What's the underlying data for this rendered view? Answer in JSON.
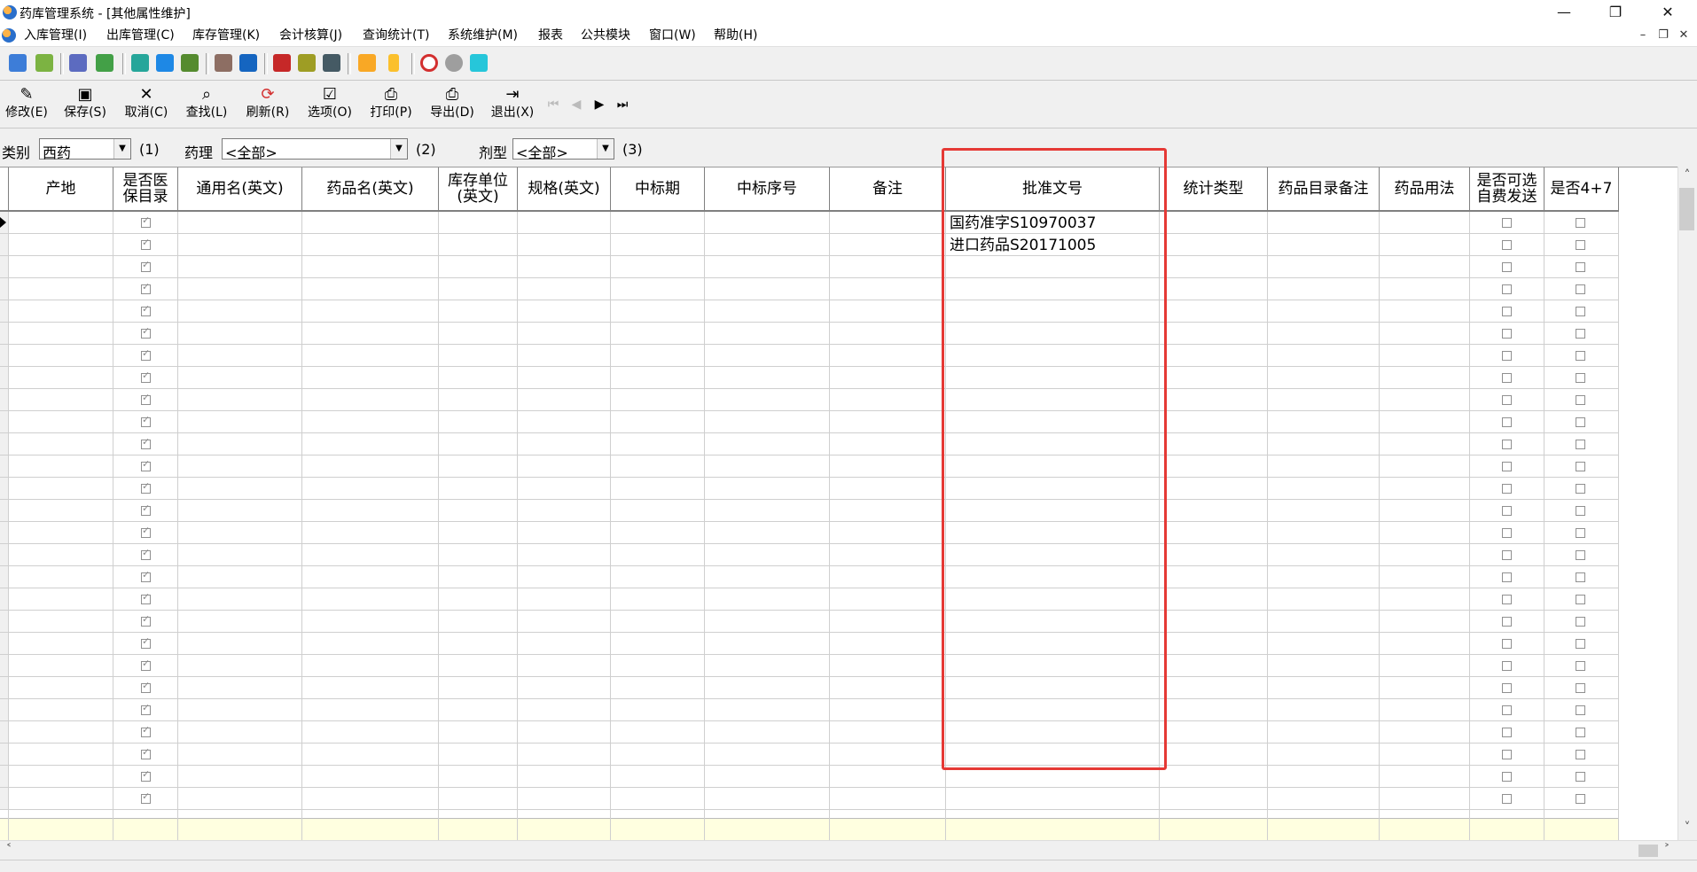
{
  "window": {
    "title": "药库管理系统 - [其他属性维护]",
    "minimize": "—",
    "maximize": "❐",
    "close": "✕"
  },
  "menu": [
    "入库管理(I)",
    "出库管理(C)",
    "库存管理(K)",
    "会计核算(J)",
    "查询统计(T)",
    "系统维护(M)",
    "报表",
    "公共模块",
    "窗口(W)",
    "帮助(H)"
  ],
  "mdi": {
    "minimize": "–",
    "restore": "❐",
    "close": "✕"
  },
  "toolbar": {
    "edit": "修改(E)",
    "save": "保存(S)",
    "cancel": "取消(C)",
    "find": "查找(L)",
    "refresh": "刷新(R)",
    "options": "选项(O)",
    "print": "打印(P)",
    "export": "导出(D)",
    "exit": "退出(X)"
  },
  "filters": {
    "category_label": "类别",
    "category_value": "西药",
    "category_hint": "(1)",
    "pharm_label": "药理",
    "pharm_value": "<全部>",
    "pharm_hint": "(2)",
    "form_label": "剂型",
    "form_value": "<全部>",
    "form_hint": "(3)"
  },
  "columns": [
    "产地",
    "是否医保目录",
    "通用名(英文)",
    "药品名(英文)",
    "库存单位(英文)",
    "规格(英文)",
    "中标期",
    "中标序号",
    "备注",
    "批准文号",
    "统计类型",
    "药品目录备注",
    "药品用法",
    "是否可选自费发送",
    "是否4+7"
  ],
  "approval_numbers": [
    "国药准字S10970037",
    "进口药品S20171005"
  ],
  "colors": {
    "highlight": "#e53935",
    "footer_row": "#ffffe0"
  }
}
